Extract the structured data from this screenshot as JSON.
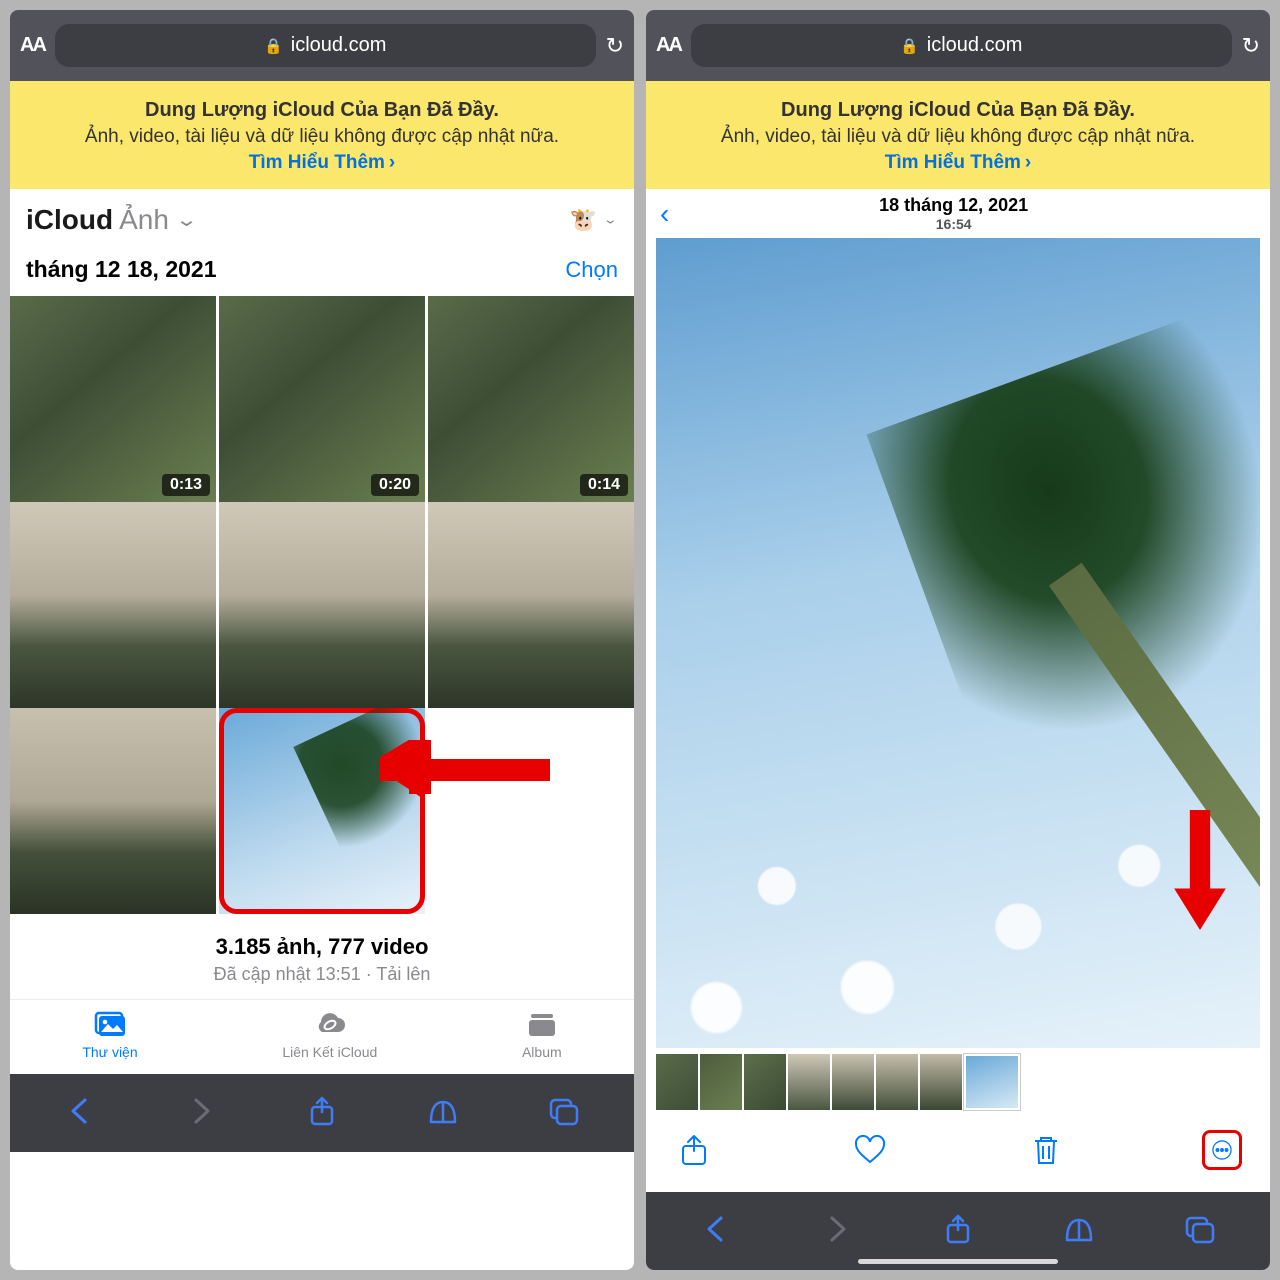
{
  "safari": {
    "aa": "AA",
    "url": "icloud.com",
    "toolbar": {}
  },
  "banner": {
    "title": "Dung Lượng iCloud Của Bạn Đã Đầy.",
    "subtitle": "Ảnh, video, tài liệu và dữ liệu không được cập nhật nữa.",
    "link": "Tìm Hiểu Thêm"
  },
  "left": {
    "app_title": "iCloud",
    "app_subtitle": "Ảnh",
    "account_emoji": "🐮",
    "date": "tháng 12 18, 2021",
    "select_label": "Chọn",
    "durations": [
      "0:13",
      "0:20",
      "0:14"
    ],
    "stats_main": "3.185 ảnh, 777 video",
    "stats_sub": "Đã cập nhật 13:51  ·  Tải lên",
    "tabs": {
      "library": "Thư viện",
      "icloud_link": "Liên Kết iCloud",
      "album": "Album"
    }
  },
  "right": {
    "date": "18 tháng 12, 2021",
    "time": "16:54"
  }
}
